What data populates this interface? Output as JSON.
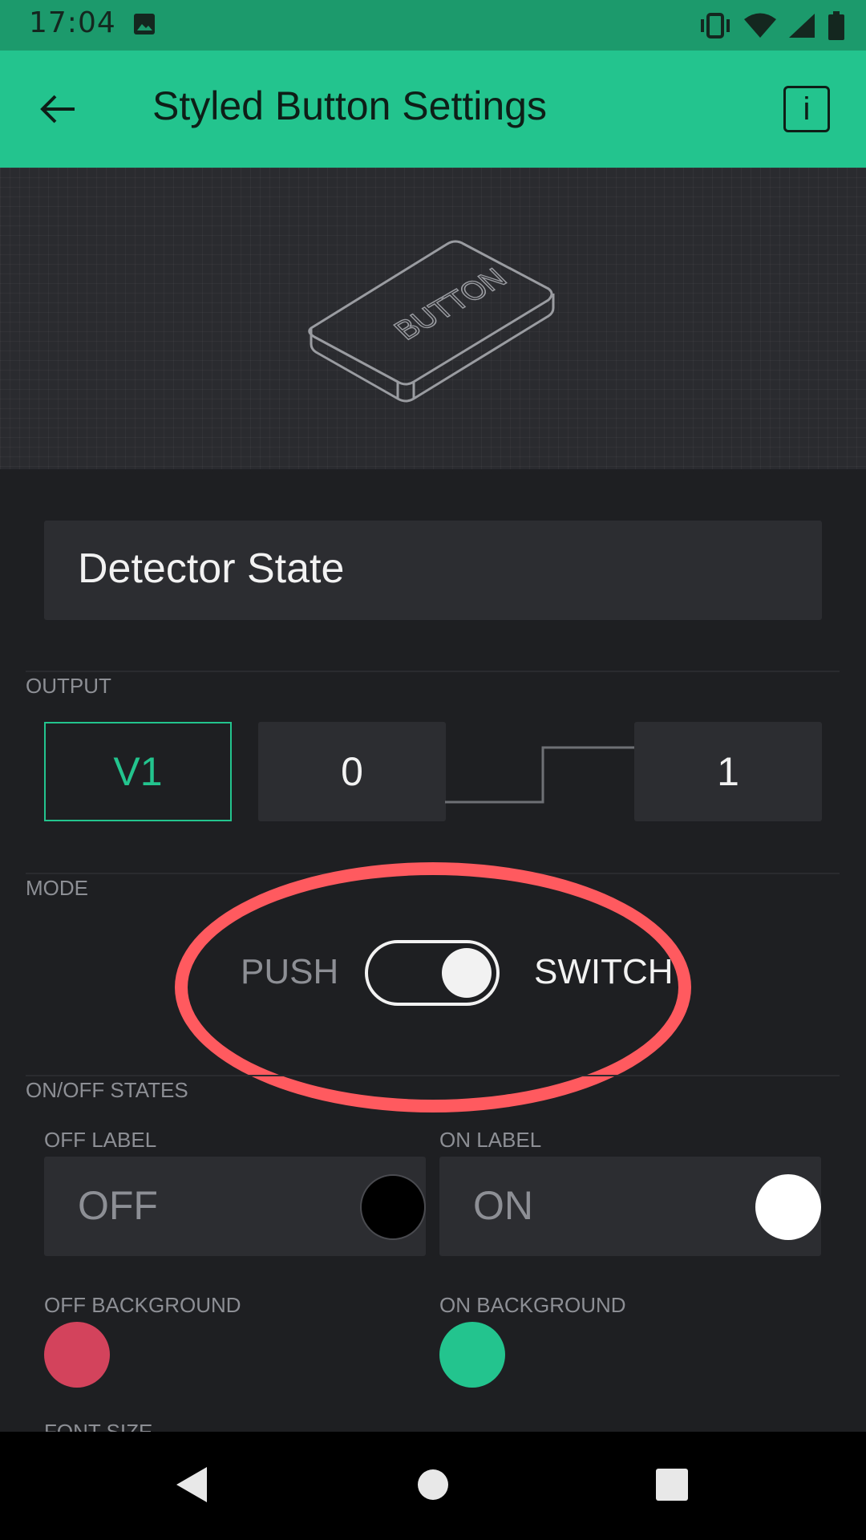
{
  "status_bar": {
    "time": "17:04",
    "icons": [
      "image-icon",
      "vibrate-icon",
      "wifi-icon",
      "signal-icon",
      "battery-icon"
    ]
  },
  "app_bar": {
    "title": "Styled Button Settings",
    "back_icon": "arrow-left-icon",
    "info_label": "i"
  },
  "preview": {
    "widget_label": "BUTTON"
  },
  "widget_name": "Detector State",
  "output": {
    "section_label": "OUTPUT",
    "pin": "V1",
    "low_value": "0",
    "high_value": "1"
  },
  "mode": {
    "section_label": "MODE",
    "option_left": "PUSH",
    "option_right": "SWITCH",
    "selected": "SWITCH"
  },
  "states": {
    "section_label": "ON/OFF STATES",
    "off_label_title": "OFF LABEL",
    "off_label_value": "OFF",
    "on_label_title": "ON LABEL",
    "on_label_value": "ON",
    "off_background_title": "OFF BACKGROUND",
    "on_background_title": "ON BACKGROUND",
    "next_section_partial": "FONT SIZE"
  },
  "colors": {
    "accent": "#23c48e",
    "off_text_color": "#000000",
    "on_text_color": "#ffffff",
    "off_background": "#d3435c",
    "on_background": "#23c48e",
    "highlight_ring": "#ff5a5f"
  },
  "nav_bar": {
    "icons": [
      "back-triangle-icon",
      "home-circle-icon",
      "recents-square-icon"
    ]
  }
}
